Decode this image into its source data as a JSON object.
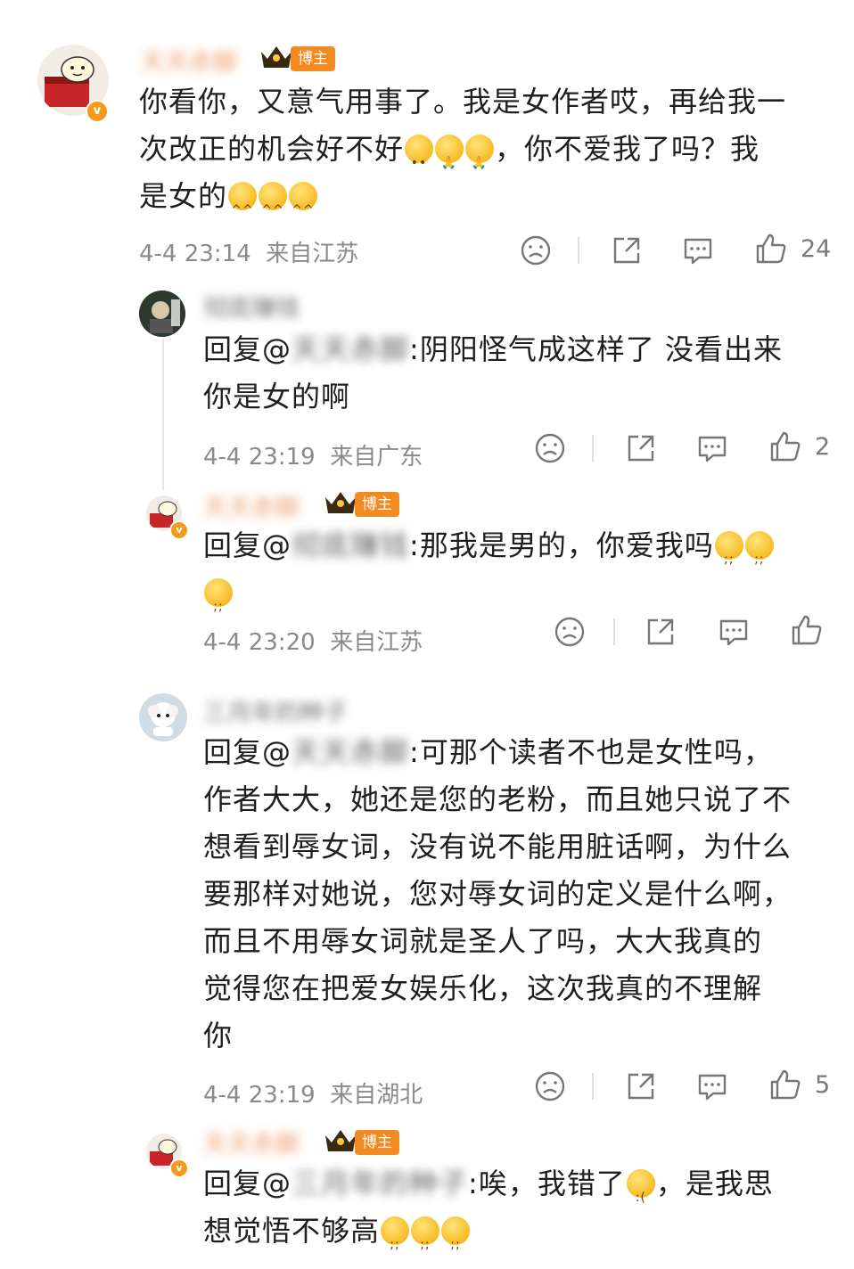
{
  "comments": [
    {
      "author": "天天赤脚",
      "badge": "博主",
      "text_a": "你看你，又意气用事了。我是女作者哎，再给我一",
      "text_b": "次改正的机会好不好",
      "text_b2": "，你不爱我了吗？我",
      "text_c": "是女的",
      "time": "4-4 23:14",
      "location": "来自江苏",
      "likes": "24"
    },
    {
      "author": "彻底赚钱",
      "reply_prefix": "回复@",
      "reply_to": "天天赤脚",
      "text_a": ":阴阳怪气成这样了 没看出来",
      "text_b": "你是女的啊",
      "time": "4-4 23:19",
      "location": "来自广东",
      "likes": "2"
    },
    {
      "author": "天天赤脚",
      "badge": "博主",
      "reply_prefix": "回复@",
      "reply_to": "彻底赚钱",
      "text_a": ":那我是男的，你爱我吗",
      "time": "4-4 23:20",
      "location": "来自江苏",
      "likes": ""
    },
    {
      "author": "三月年的种子",
      "reply_prefix": "回复@",
      "reply_to": "天天赤脚",
      "lines": [
        ":可那个读者不也是女性吗，",
        "作者大大，她还是您的老粉，而且她只说了不",
        "想看到辱女词，没有说不能用脏话啊，为什么",
        "要那样对她说，您对辱女词的定义是什么啊，",
        "而且不用辱女词就是圣人了吗，大大我真的",
        "觉得您在把爱女娱乐化，这次我真的不理解",
        "你"
      ],
      "time": "4-4 23:19",
      "location": "来自湖北",
      "likes": "5"
    },
    {
      "author": "天天赤脚",
      "badge": "博主",
      "reply_prefix": "回复@",
      "reply_to": "三月年的种子",
      "text_a": ":唉，我错了",
      "text_a2": "，是我思",
      "text_b": "想觉悟不够高"
    }
  ],
  "icons": [
    "dislike-icon",
    "share-icon",
    "comment-icon",
    "like-icon"
  ],
  "colors": {
    "author": "#e8803a",
    "badge": "#f28a22",
    "meta": "#8a8a8a"
  }
}
